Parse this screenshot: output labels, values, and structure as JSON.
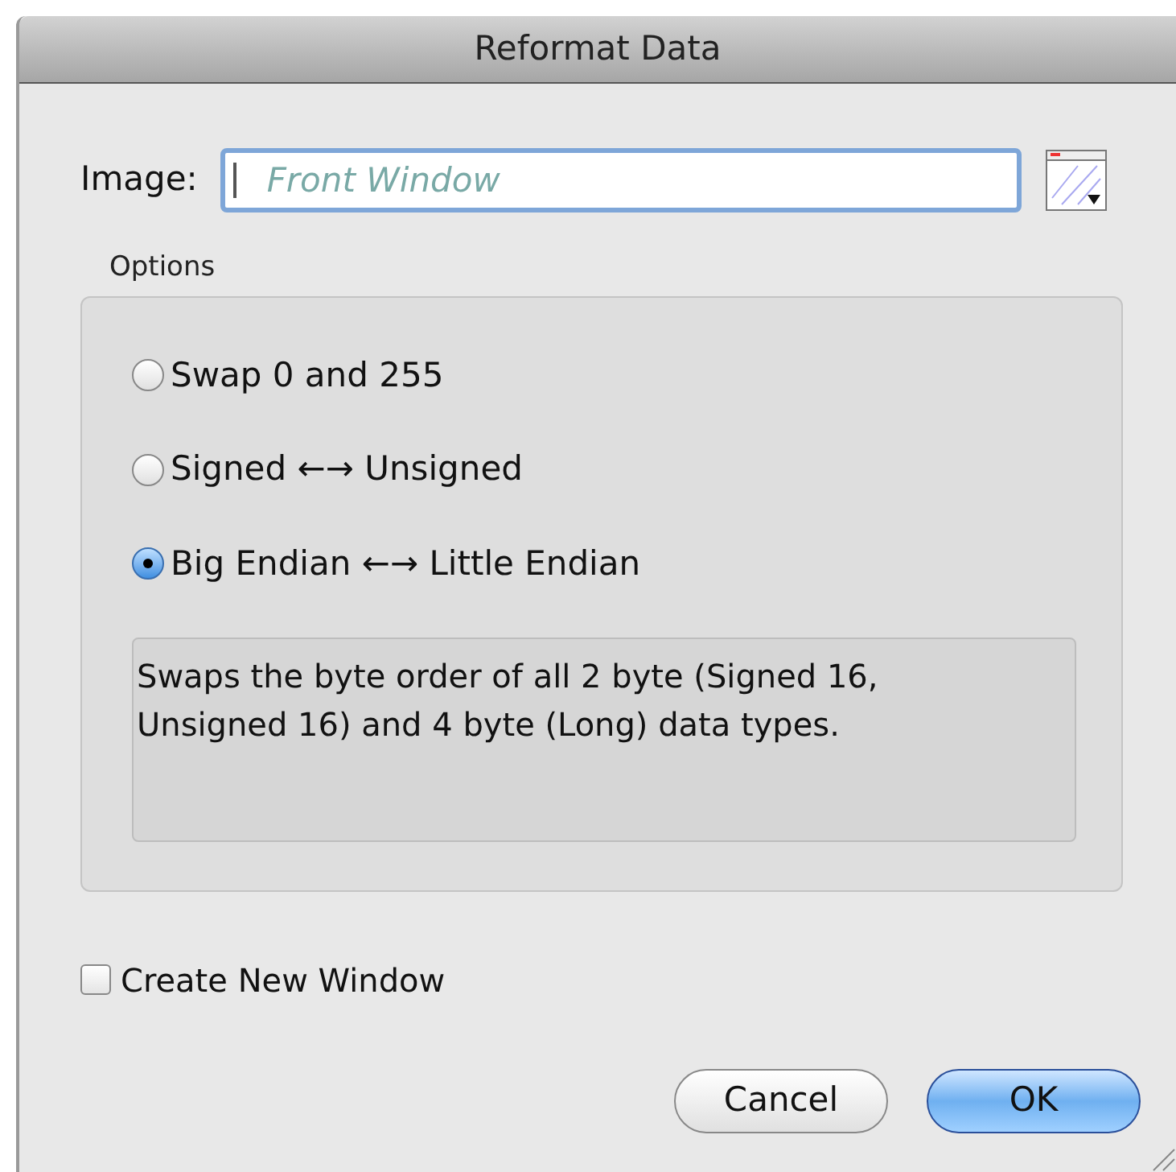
{
  "window": {
    "title": "Reformat Data"
  },
  "image_field": {
    "label": "Image:",
    "placeholder": "Front Window"
  },
  "options": {
    "title": "Options",
    "radios": [
      {
        "label": "Swap 0 and 255",
        "selected": false
      },
      {
        "label": "Signed ←→ Unsigned",
        "selected": false
      },
      {
        "label": "Big Endian ←→ Little Endian",
        "selected": true
      }
    ],
    "description": "Swaps the byte order of all 2 byte (Signed 16, Unsigned 16) and 4 byte (Long) data types."
  },
  "create_new_window": {
    "label": "Create New Window",
    "checked": false
  },
  "buttons": [
    {
      "label": "Cancel",
      "kind": "normal"
    },
    {
      "label": "OK",
      "kind": "default"
    }
  ]
}
